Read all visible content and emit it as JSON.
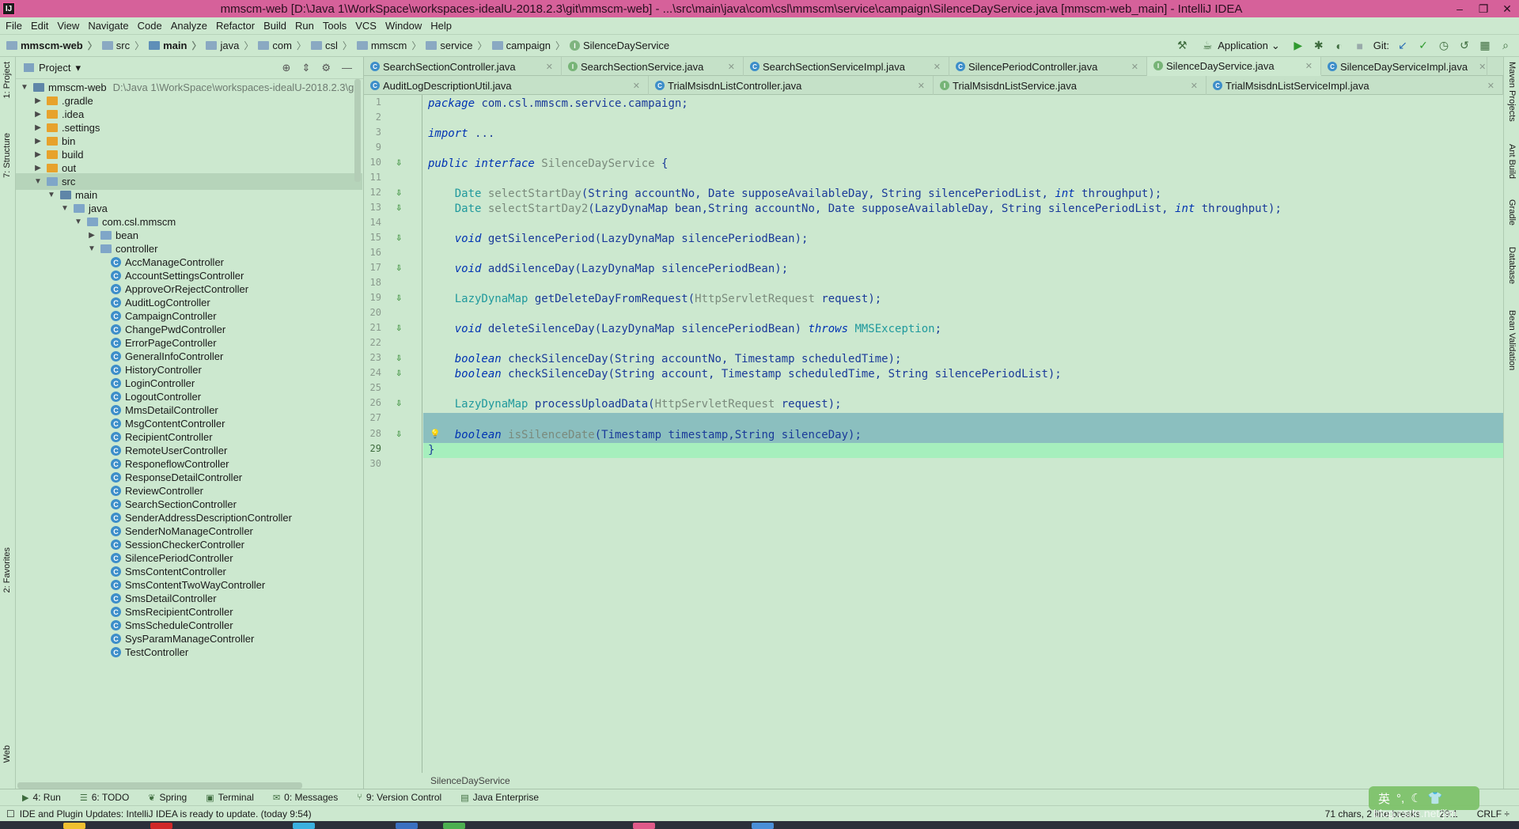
{
  "window": {
    "title": "mmscm-web [D:\\Java 1\\WorkSpace\\workspaces-idealU-2018.2.3\\git\\mmscm-web] - ...\\src\\main\\java\\com\\csl\\mmscm\\service\\campaign\\SilenceDayService.java [mmscm-web_main] - IntelliJ IDEA",
    "minimize": "–",
    "restore": "❐",
    "close": "✕",
    "app_icon": "IJ"
  },
  "menu": [
    "File",
    "Edit",
    "View",
    "Navigate",
    "Code",
    "Analyze",
    "Refactor",
    "Build",
    "Run",
    "Tools",
    "VCS",
    "Window",
    "Help"
  ],
  "breadcrumb": [
    "mmscm-web",
    "src",
    "main",
    "java",
    "com",
    "csl",
    "mmscm",
    "service",
    "campaign",
    "SilenceDayService"
  ],
  "toolbar": {
    "run_config": "Application",
    "git_label": "Git:"
  },
  "left_stripe": {
    "project": "1: Project",
    "structure": "7: Structure",
    "favorites": "2: Favorites",
    "web": "Web"
  },
  "right_stripe": [
    "Maven Projects",
    "Ant Build",
    "Gradle",
    "Database",
    "Bean Validation"
  ],
  "project_panel": {
    "title": "Project",
    "root": {
      "name": "mmscm-web",
      "path": "D:\\Java 1\\WorkSpace\\workspaces-idealU-2018.2.3\\git"
    },
    "items": [
      {
        "label": ".gradle",
        "level": 1,
        "kind": "folder",
        "arrow": "▶"
      },
      {
        "label": ".idea",
        "level": 1,
        "kind": "folder",
        "arrow": "▶"
      },
      {
        "label": ".settings",
        "level": 1,
        "kind": "folder",
        "arrow": "▶"
      },
      {
        "label": "bin",
        "level": 1,
        "kind": "folder",
        "arrow": "▶"
      },
      {
        "label": "build",
        "level": 1,
        "kind": "folder",
        "arrow": "▶"
      },
      {
        "label": "out",
        "level": 1,
        "kind": "folder",
        "arrow": "▶"
      },
      {
        "label": "src",
        "level": 1,
        "kind": "folder-blue",
        "arrow": "▼",
        "selected": true
      },
      {
        "label": "main",
        "level": 2,
        "kind": "folder-mod",
        "arrow": "▼"
      },
      {
        "label": "java",
        "level": 3,
        "kind": "folder-blue",
        "arrow": "▼"
      },
      {
        "label": "com.csl.mmscm",
        "level": 4,
        "kind": "folder-blue",
        "arrow": "▼"
      },
      {
        "label": "bean",
        "level": 5,
        "kind": "folder-blue",
        "arrow": "▶"
      },
      {
        "label": "controller",
        "level": 5,
        "kind": "folder-blue",
        "arrow": "▼"
      },
      {
        "label": "AccManageController",
        "level": 6,
        "kind": "class"
      },
      {
        "label": "AccountSettingsController",
        "level": 6,
        "kind": "class"
      },
      {
        "label": "ApproveOrRejectController",
        "level": 6,
        "kind": "class"
      },
      {
        "label": "AuditLogController",
        "level": 6,
        "kind": "class"
      },
      {
        "label": "CampaignController",
        "level": 6,
        "kind": "class"
      },
      {
        "label": "ChangePwdController",
        "level": 6,
        "kind": "class"
      },
      {
        "label": "ErrorPageController",
        "level": 6,
        "kind": "class"
      },
      {
        "label": "GeneralInfoController",
        "level": 6,
        "kind": "class"
      },
      {
        "label": "HistoryController",
        "level": 6,
        "kind": "class"
      },
      {
        "label": "LoginController",
        "level": 6,
        "kind": "class"
      },
      {
        "label": "LogoutController",
        "level": 6,
        "kind": "class"
      },
      {
        "label": "MmsDetailController",
        "level": 6,
        "kind": "class"
      },
      {
        "label": "MsgContentController",
        "level": 6,
        "kind": "class"
      },
      {
        "label": "RecipientController",
        "level": 6,
        "kind": "class"
      },
      {
        "label": "RemoteUserController",
        "level": 6,
        "kind": "class"
      },
      {
        "label": "ResponeflowController",
        "level": 6,
        "kind": "class"
      },
      {
        "label": "ResponseDetailController",
        "level": 6,
        "kind": "class"
      },
      {
        "label": "ReviewController",
        "level": 6,
        "kind": "class"
      },
      {
        "label": "SearchSectionController",
        "level": 6,
        "kind": "class"
      },
      {
        "label": "SenderAddressDescriptionController",
        "level": 6,
        "kind": "class"
      },
      {
        "label": "SenderNoManageController",
        "level": 6,
        "kind": "class"
      },
      {
        "label": "SessionCheckerController",
        "level": 6,
        "kind": "class"
      },
      {
        "label": "SilencePeriodController",
        "level": 6,
        "kind": "class"
      },
      {
        "label": "SmsContentController",
        "level": 6,
        "kind": "class"
      },
      {
        "label": "SmsContentTwoWayController",
        "level": 6,
        "kind": "class"
      },
      {
        "label": "SmsDetailController",
        "level": 6,
        "kind": "class"
      },
      {
        "label": "SmsRecipientController",
        "level": 6,
        "kind": "class"
      },
      {
        "label": "SmsScheduleController",
        "level": 6,
        "kind": "class"
      },
      {
        "label": "SysParamManageController",
        "level": 6,
        "kind": "class"
      },
      {
        "label": "TestController",
        "level": 6,
        "kind": "class"
      }
    ]
  },
  "tabs_row1": [
    {
      "label": "SearchSectionController.java",
      "icon": "c"
    },
    {
      "label": "SearchSectionService.java",
      "icon": "i"
    },
    {
      "label": "SearchSectionServiceImpl.java",
      "icon": "c"
    },
    {
      "label": "SilencePeriodController.java",
      "icon": "c"
    },
    {
      "label": "SilenceDayService.java",
      "icon": "i",
      "active": true
    },
    {
      "label": "SilenceDayServiceImpl.java",
      "icon": "c"
    }
  ],
  "tabs_row2": [
    {
      "label": "AuditLogDescriptionUtil.java",
      "icon": "c"
    },
    {
      "label": "TrialMsisdnListController.java",
      "icon": "c"
    },
    {
      "label": "TrialMsisdnListService.java",
      "icon": "i"
    },
    {
      "label": "TrialMsisdnListServiceImpl.java",
      "icon": "c"
    }
  ],
  "code": {
    "line_numbers": [
      "1",
      "2",
      "3",
      "9",
      "10",
      "11",
      "12",
      "13",
      "14",
      "15",
      "16",
      "17",
      "18",
      "19",
      "20",
      "21",
      "22",
      "23",
      "24",
      "25",
      "26",
      "27",
      "28",
      "29",
      "30"
    ],
    "current_line": "29",
    "lines": [
      [
        {
          "t": "package ",
          "c": "kw"
        },
        {
          "t": "com.csl.mmscm.service.campaign;",
          "c": "idf"
        }
      ],
      [],
      [
        {
          "t": "import ",
          "c": "kw"
        },
        {
          "t": "...",
          "c": "idf"
        }
      ],
      [],
      [
        {
          "t": "public interface ",
          "c": "kw"
        },
        {
          "t": "SilenceDayService ",
          "c": "gray"
        },
        {
          "t": "{",
          "c": "idf"
        }
      ],
      [],
      [
        {
          "t": "    Date ",
          "c": "ty"
        },
        {
          "t": "selectStartDay",
          "c": "gray"
        },
        {
          "t": "(String accountNo, Date supposeAvailableDay, String silencePeriodList, ",
          "c": "idf"
        },
        {
          "t": "int ",
          "c": "kw"
        },
        {
          "t": "throughput);",
          "c": "idf"
        }
      ],
      [
        {
          "t": "    Date ",
          "c": "ty"
        },
        {
          "t": "selectStartDay2",
          "c": "gray"
        },
        {
          "t": "(LazyDynaMap bean,String accountNo, Date supposeAvailableDay, String silencePeriodList, ",
          "c": "idf"
        },
        {
          "t": "int ",
          "c": "kw"
        },
        {
          "t": "throughput);",
          "c": "idf"
        }
      ],
      [],
      [
        {
          "t": "    void ",
          "c": "kw"
        },
        {
          "t": "getSilencePeriod(LazyDynaMap silencePeriodBean);",
          "c": "idf"
        }
      ],
      [],
      [
        {
          "t": "    void ",
          "c": "kw"
        },
        {
          "t": "addSilenceDay(LazyDynaMap silencePeriodBean);",
          "c": "idf"
        }
      ],
      [],
      [
        {
          "t": "    LazyDynaMap ",
          "c": "ty"
        },
        {
          "t": "getDeleteDayFromRequest(",
          "c": "idf"
        },
        {
          "t": "HttpServletRequest ",
          "c": "gray"
        },
        {
          "t": "request);",
          "c": "idf"
        }
      ],
      [],
      [
        {
          "t": "    void ",
          "c": "kw"
        },
        {
          "t": "deleteSilenceDay(LazyDynaMap silencePeriodBean) ",
          "c": "idf"
        },
        {
          "t": "throws ",
          "c": "kw"
        },
        {
          "t": "MMSException",
          "c": "ty"
        },
        {
          "t": ";",
          "c": "idf"
        }
      ],
      [],
      [
        {
          "t": "    boolean ",
          "c": "kw"
        },
        {
          "t": "checkSilenceDay(String accountNo, Timestamp scheduledTime);",
          "c": "idf"
        }
      ],
      [
        {
          "t": "    boolean ",
          "c": "kw"
        },
        {
          "t": "checkSilenceDay(String account, Timestamp scheduledTime, String silencePeriodList);",
          "c": "idf"
        }
      ],
      [],
      [
        {
          "t": "    LazyDynaMap ",
          "c": "ty"
        },
        {
          "t": "processUploadData(",
          "c": "idf"
        },
        {
          "t": "HttpServletRequest ",
          "c": "gray"
        },
        {
          "t": "request);",
          "c": "idf"
        }
      ],
      [],
      [
        {
          "t": "    boolean ",
          "c": "kw"
        },
        {
          "t": "isSilenceDate",
          "c": "gray"
        },
        {
          "t": "(Timestamp timestamp,String silenceDay);",
          "c": "idf"
        }
      ],
      [
        {
          "t": "}",
          "c": "idf"
        }
      ],
      []
    ],
    "breadcrumb_footer": "SilenceDayService"
  },
  "bottom_tools": [
    {
      "label": "4: Run",
      "icon": "▶"
    },
    {
      "label": "6: TODO",
      "icon": "☰"
    },
    {
      "label": "Spring",
      "icon": "❦"
    },
    {
      "label": "Terminal",
      "icon": "▣"
    },
    {
      "label": "0: Messages",
      "icon": "✉"
    },
    {
      "label": "9: Version Control",
      "icon": "⑂"
    },
    {
      "label": "Java Enterprise",
      "icon": "▤"
    }
  ],
  "status": {
    "message": "IDE and Plugin Updates: IntelliJ IDEA is ready to update. (today 9:54)",
    "chars": "71 chars, 2 line breaks",
    "position": "29:1",
    "line_sep": "CRLF ÷"
  },
  "tray": {
    "ime": "英",
    "watermark": "blog.csdn.net/jim"
  },
  "colors": {
    "accent_title": "#d6619a",
    "editor_bg": "#cce8cf",
    "selection": "#8bbfbf",
    "caret_row": "#a6efbd"
  }
}
